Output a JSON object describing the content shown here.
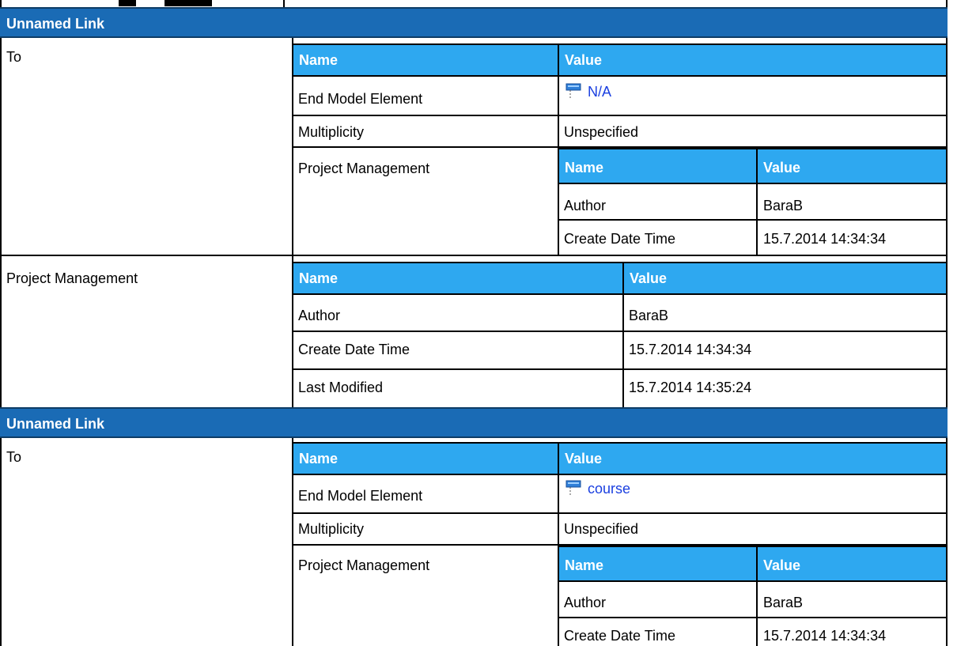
{
  "headers": {
    "name": "Name",
    "value": "Value"
  },
  "sections": [
    {
      "title": "Unnamed Link",
      "to_label": "To",
      "rows": {
        "end_model_element": {
          "label": "End Model Element",
          "value": "N/A"
        },
        "multiplicity": {
          "label": "Multiplicity",
          "value": "Unspecified"
        },
        "project_management": {
          "label": "Project Management",
          "author": {
            "label": "Author",
            "value": "BaraB"
          },
          "create": {
            "label": "Create Date Time",
            "value": "15.7.2014 14:34:34"
          }
        }
      },
      "pm": {
        "label": "Project Management",
        "author": {
          "label": "Author",
          "value": "BaraB"
        },
        "create": {
          "label": "Create Date Time",
          "value": "15.7.2014 14:34:34"
        },
        "modified": {
          "label": "Last Modified",
          "value": "15.7.2014 14:35:24"
        }
      }
    },
    {
      "title": "Unnamed Link",
      "to_label": "To",
      "rows": {
        "end_model_element": {
          "label": "End Model Element",
          "value": "course"
        },
        "multiplicity": {
          "label": "Multiplicity",
          "value": "Unspecified"
        },
        "project_management": {
          "label": "Project Management",
          "author": {
            "label": "Author",
            "value": "BaraB"
          },
          "create": {
            "label": "Create Date Time",
            "value": "15.7.2014 14:34:34"
          }
        }
      }
    }
  ],
  "icons": {
    "element": "model-element-icon"
  },
  "colors": {
    "section_header": "#1a6bb5",
    "table_header": "#2ea8f0",
    "link": "#1a3fe0"
  }
}
